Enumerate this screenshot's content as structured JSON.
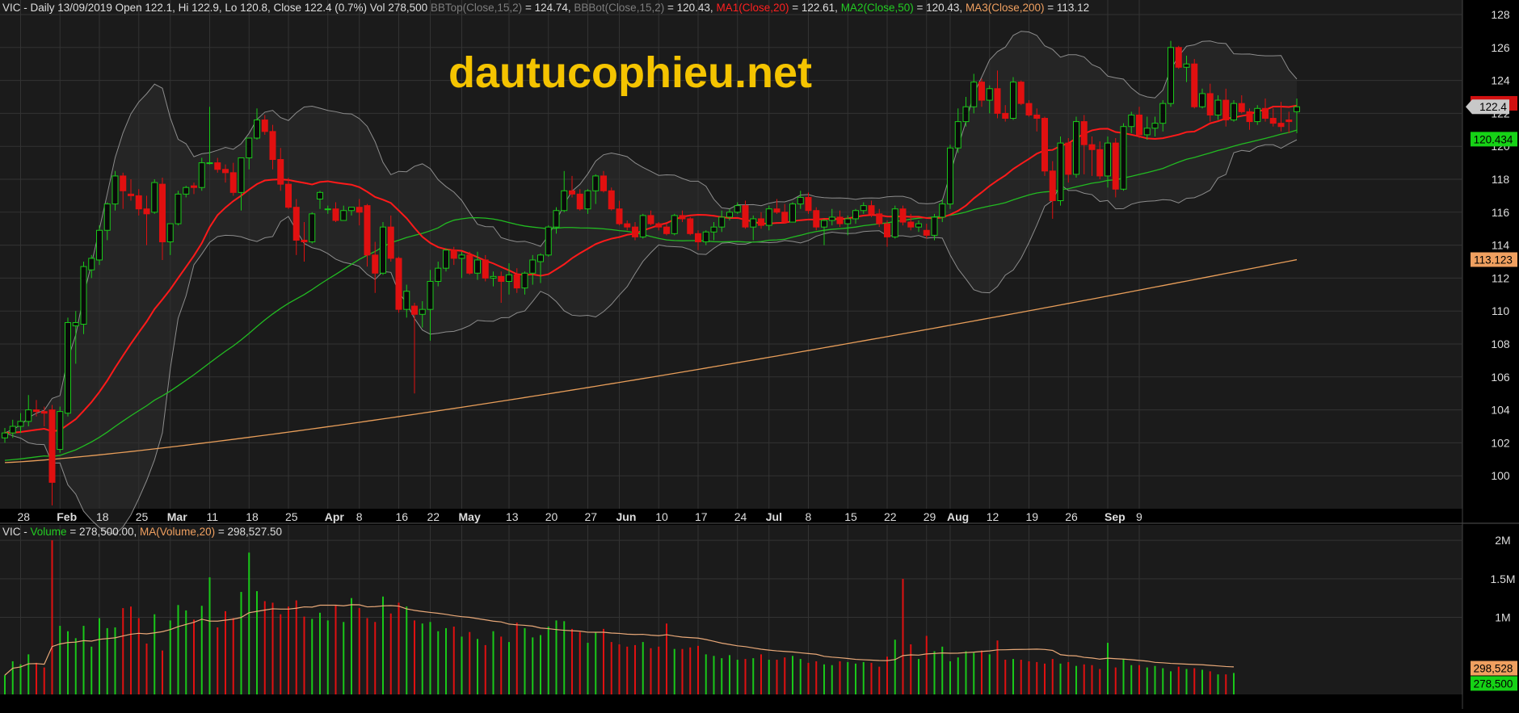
{
  "colors": {
    "background": "#000000",
    "panel": "#1b1b1b",
    "grid": "#333333",
    "up": "#19c819",
    "down": "#e01010",
    "ma20": "#ff1a1a",
    "ma50": "#22bb22",
    "ma200": "#e89e5a",
    "bollinger": "#8c8c8c",
    "volume_ma": "#e8a878",
    "watermark": "#f5c400",
    "text": "#dddddd"
  },
  "header": {
    "symbol": "VIC",
    "main_label": "VIC - Daily 13/09/2019 Open 122.1, Hi 122.9, Lo 120.8, Close 122.4 (0.7%) Vol 278,500",
    "bbtop_label": "BBTop(Close,15,2)",
    "bbtop_value": "= 124.74,",
    "bbbot_label": "BBBot(Close,15,2)",
    "bbbot_value": "= 120.43,",
    "ma1_label": "MA1(Close,20)",
    "ma1_value": "= 122.61,",
    "ma2_label": "MA2(Close,50)",
    "ma2_value": "= 120.43,",
    "ma3_label": "MA3(Close,200)",
    "ma3_value": "= 113.12",
    "volume_prefix": "VIC -",
    "volume_label": "Volume",
    "volume_value": "= 278,500.00,",
    "volume_ma_label": "MA(Volume,20)",
    "volume_ma_value": "= 298,527.50"
  },
  "watermark": "dautucophieu.net",
  "badges": {
    "ma20": "122.61",
    "close": "122.4",
    "ma50": "120.434",
    "ma200": "113.123",
    "vol_ma": "298,528",
    "vol": "278,500"
  },
  "chart_data": [
    {
      "type": "candlestick",
      "title": "VIC - Daily",
      "ylim": [
        98,
        128
      ],
      "yticks": [
        100,
        102,
        104,
        106,
        108,
        110,
        112,
        114,
        116,
        118,
        120,
        122,
        124,
        126,
        128
      ],
      "x_tick_labels": [
        "28",
        "Feb",
        "18",
        "25",
        "Mar",
        "11",
        "18",
        "25",
        "Apr",
        "8",
        "16",
        "22",
        "May",
        "13",
        "20",
        "27",
        "Jun",
        "10",
        "17",
        "24",
        "Jul",
        "8",
        "15",
        "22",
        "29",
        "Aug",
        "12",
        "19",
        "26",
        "Sep",
        "9"
      ],
      "x_tick_index": [
        2,
        7,
        12,
        17,
        21,
        26,
        31,
        36,
        41,
        45,
        50,
        54,
        58,
        64,
        69,
        74,
        78,
        83,
        88,
        93,
        97,
        102,
        107,
        112,
        117,
        120,
        125,
        130,
        135,
        140,
        144
      ],
      "ohlc": [
        [
          102.3,
          102.9,
          102.0,
          102.6
        ],
        [
          102.6,
          103.4,
          102.3,
          103.0
        ],
        [
          103.0,
          103.8,
          102.6,
          103.3
        ],
        [
          103.3,
          104.9,
          103.0,
          104.0
        ],
        [
          104.0,
          104.6,
          103.6,
          103.9
        ],
        [
          103.9,
          104.2,
          103.0,
          103.8
        ],
        [
          104.0,
          104.3,
          98.2,
          99.6
        ],
        [
          101.6,
          104.2,
          101.4,
          103.9
        ],
        [
          103.8,
          109.6,
          103.6,
          109.3
        ],
        [
          109.1,
          110.0,
          106.8,
          109.3
        ],
        [
          109.2,
          113.0,
          108.6,
          112.7
        ],
        [
          112.5,
          113.4,
          112.0,
          113.2
        ],
        [
          113.1,
          115.2,
          112.8,
          114.9
        ],
        [
          114.9,
          116.6,
          114.3,
          116.5
        ],
        [
          116.5,
          118.5,
          116.1,
          118.2
        ],
        [
          118.2,
          118.4,
          116.2,
          117.3
        ],
        [
          117.1,
          118.0,
          116.7,
          117.0
        ],
        [
          117.0,
          117.4,
          115.8,
          116.2
        ],
        [
          116.2,
          117.0,
          114.0,
          115.9
        ],
        [
          116.0,
          118.0,
          115.9,
          117.8
        ],
        [
          117.7,
          118.1,
          113.1,
          114.2
        ],
        [
          114.2,
          115.3,
          113.4,
          115.3
        ],
        [
          115.3,
          117.3,
          115.2,
          117.1
        ],
        [
          117.1,
          117.6,
          116.9,
          117.5
        ],
        [
          117.6,
          117.8,
          117.1,
          117.5
        ],
        [
          117.5,
          119.3,
          117.3,
          119.0
        ],
        [
          119.0,
          122.4,
          118.9,
          119.0
        ],
        [
          119.0,
          119.3,
          118.4,
          118.6
        ],
        [
          118.6,
          118.9,
          117.8,
          118.4
        ],
        [
          118.4,
          119.0,
          117.0,
          117.2
        ],
        [
          117.2,
          119.3,
          116.1,
          119.3
        ],
        [
          119.3,
          120.5,
          118.6,
          120.5
        ],
        [
          120.5,
          122.3,
          120.4,
          121.6
        ],
        [
          121.6,
          121.9,
          120.7,
          120.9
        ],
        [
          120.9,
          121.3,
          118.6,
          119.2
        ],
        [
          119.2,
          119.9,
          117.3,
          117.7
        ],
        [
          117.7,
          118.1,
          116.2,
          116.3
        ],
        [
          116.3,
          116.8,
          113.4,
          114.3
        ],
        [
          114.3,
          115.4,
          113.0,
          114.2
        ],
        [
          114.2,
          116.0,
          114.1,
          115.9
        ],
        [
          116.8,
          117.3,
          116.2,
          117.2
        ],
        [
          116.2,
          116.4,
          115.9,
          116.2
        ],
        [
          116.2,
          116.6,
          115.4,
          115.5
        ],
        [
          115.5,
          116.4,
          115.5,
          116.1
        ],
        [
          116.1,
          116.3,
          115.8,
          116.3
        ],
        [
          116.3,
          116.8,
          115.2,
          116.0
        ],
        [
          116.4,
          116.5,
          112.7,
          113.4
        ],
        [
          113.4,
          114.2,
          111.1,
          112.3
        ],
        [
          112.3,
          115.4,
          112.2,
          115.1
        ],
        [
          115.1,
          115.8,
          113.0,
          113.2
        ],
        [
          113.2,
          113.3,
          109.9,
          110.1
        ],
        [
          110.1,
          111.6,
          109.6,
          111.2
        ],
        [
          110.3,
          110.5,
          105.0,
          109.8
        ],
        [
          109.8,
          110.6,
          109.0,
          110.1
        ],
        [
          110.1,
          112.5,
          108.2,
          111.8
        ],
        [
          111.8,
          113.0,
          111.5,
          112.6
        ],
        [
          112.6,
          113.8,
          112.4,
          113.7
        ],
        [
          113.7,
          113.9,
          112.8,
          113.2
        ],
        [
          113.2,
          113.6,
          112.0,
          113.4
        ],
        [
          113.4,
          113.6,
          112.2,
          112.3
        ],
        [
          112.3,
          113.6,
          111.9,
          113.1
        ],
        [
          113.1,
          113.4,
          111.8,
          112.0
        ],
        [
          112.0,
          112.4,
          111.5,
          112.1
        ],
        [
          112.1,
          112.4,
          110.5,
          111.8
        ],
        [
          111.8,
          112.9,
          111.0,
          112.2
        ],
        [
          112.2,
          112.6,
          111.1,
          111.4
        ],
        [
          111.4,
          112.4,
          111.0,
          112.3
        ],
        [
          112.3,
          113.4,
          111.6,
          113.1
        ],
        [
          113.0,
          113.5,
          111.7,
          113.4
        ],
        [
          113.4,
          115.2,
          113.3,
          115.1
        ],
        [
          115.1,
          116.3,
          114.7,
          116.1
        ],
        [
          116.1,
          118.5,
          116.0,
          117.3
        ],
        [
          117.3,
          118.2,
          116.9,
          117.1
        ],
        [
          117.1,
          117.4,
          116.1,
          116.2
        ],
        [
          116.2,
          117.4,
          115.9,
          117.3
        ],
        [
          117.3,
          118.3,
          116.5,
          118.2
        ],
        [
          118.2,
          118.5,
          117.2,
          117.3
        ],
        [
          117.3,
          117.5,
          116.1,
          116.2
        ],
        [
          116.2,
          116.7,
          115.2,
          115.3
        ],
        [
          115.3,
          115.5,
          114.9,
          115.1
        ],
        [
          115.1,
          115.4,
          114.3,
          114.5
        ],
        [
          114.5,
          115.9,
          114.4,
          115.8
        ],
        [
          115.8,
          116.1,
          115.2,
          115.3
        ],
        [
          115.3,
          115.4,
          114.9,
          115.1
        ],
        [
          115.1,
          115.3,
          114.6,
          114.7
        ],
        [
          114.7,
          115.9,
          114.6,
          115.8
        ],
        [
          115.8,
          116.1,
          115.4,
          115.6
        ],
        [
          115.6,
          115.7,
          114.6,
          114.7
        ],
        [
          114.7,
          114.9,
          113.7,
          114.2
        ],
        [
          114.2,
          114.9,
          114.0,
          114.8
        ],
        [
          114.8,
          115.4,
          114.3,
          115.1
        ],
        [
          115.1,
          116.1,
          114.8,
          115.7
        ],
        [
          115.7,
          116.2,
          115.5,
          116.0
        ],
        [
          116.0,
          116.6,
          115.9,
          116.4
        ],
        [
          116.4,
          116.7,
          115.0,
          115.1
        ],
        [
          115.1,
          115.8,
          114.3,
          115.6
        ],
        [
          115.6,
          116.0,
          115.0,
          115.2
        ],
        [
          115.2,
          116.4,
          114.9,
          116.2
        ],
        [
          116.2,
          116.8,
          115.9,
          116.0
        ],
        [
          116.0,
          116.5,
          115.3,
          115.4
        ],
        [
          115.4,
          116.6,
          115.4,
          116.5
        ],
        [
          116.5,
          117.3,
          116.2,
          116.9
        ],
        [
          116.9,
          117.2,
          115.9,
          116.1
        ],
        [
          116.1,
          116.3,
          114.9,
          115.1
        ],
        [
          115.1,
          115.6,
          114.0,
          115.5
        ],
        [
          115.5,
          116.2,
          115.2,
          115.7
        ],
        [
          115.7,
          116.1,
          115.1,
          115.3
        ],
        [
          115.3,
          115.8,
          114.6,
          115.6
        ],
        [
          115.6,
          116.2,
          115.3,
          116.1
        ],
        [
          116.1,
          116.6,
          115.9,
          116.4
        ],
        [
          116.4,
          116.7,
          115.7,
          115.9
        ],
        [
          115.9,
          116.2,
          115.1,
          115.3
        ],
        [
          115.3,
          115.5,
          113.9,
          114.5
        ],
        [
          114.5,
          116.4,
          114.4,
          116.2
        ],
        [
          116.2,
          116.4,
          115.2,
          115.4
        ],
        [
          115.4,
          115.9,
          114.9,
          115.1
        ],
        [
          115.1,
          115.5,
          114.8,
          115.3
        ],
        [
          114.9,
          115.3,
          114.4,
          114.6
        ],
        [
          114.6,
          115.9,
          114.3,
          115.7
        ],
        [
          115.7,
          116.8,
          115.4,
          116.5
        ],
        [
          116.5,
          120.1,
          116.2,
          119.9
        ],
        [
          119.9,
          122.3,
          119.6,
          121.5
        ],
        [
          121.5,
          123.0,
          121.2,
          122.4
        ],
        [
          122.4,
          124.4,
          122.0,
          123.9
        ],
        [
          123.9,
          124.1,
          122.4,
          122.8
        ],
        [
          122.8,
          123.7,
          122.0,
          123.5
        ],
        [
          123.5,
          124.6,
          121.7,
          122.0
        ],
        [
          122.0,
          122.5,
          121.5,
          121.7
        ],
        [
          121.7,
          124.2,
          121.6,
          123.9
        ],
        [
          123.9,
          124.0,
          122.5,
          122.6
        ],
        [
          122.6,
          122.8,
          121.8,
          121.9
        ],
        [
          121.9,
          122.3,
          120.9,
          121.7
        ],
        [
          121.7,
          121.8,
          118.2,
          118.5
        ],
        [
          118.5,
          119.1,
          115.6,
          116.7
        ],
        [
          116.7,
          120.6,
          116.4,
          120.2
        ],
        [
          120.2,
          120.5,
          117.8,
          118.3
        ],
        [
          118.3,
          121.8,
          118.1,
          121.5
        ],
        [
          121.5,
          121.9,
          118.3,
          120.1
        ],
        [
          120.1,
          120.6,
          118.2,
          119.8
        ],
        [
          119.8,
          120.3,
          118.0,
          118.2
        ],
        [
          118.2,
          120.6,
          117.5,
          120.2
        ],
        [
          120.2,
          120.5,
          116.9,
          117.4
        ],
        [
          117.4,
          121.4,
          117.3,
          121.2
        ],
        [
          121.2,
          122.1,
          120.8,
          121.9
        ],
        [
          121.9,
          122.4,
          120.5,
          120.7
        ],
        [
          120.7,
          121.8,
          120.4,
          121.1
        ],
        [
          121.1,
          121.8,
          120.6,
          121.4
        ],
        [
          121.4,
          122.8,
          120.9,
          122.6
        ],
        [
          122.6,
          126.4,
          122.4,
          126.0
        ],
        [
          126.0,
          126.1,
          124.7,
          124.8
        ],
        [
          124.8,
          125.5,
          123.9,
          125.0
        ],
        [
          125.0,
          125.3,
          122.3,
          122.4
        ],
        [
          122.4,
          123.5,
          122.3,
          123.2
        ],
        [
          123.2,
          123.8,
          121.5,
          121.9
        ],
        [
          121.9,
          123.1,
          121.6,
          122.8
        ],
        [
          122.8,
          123.5,
          121.2,
          121.6
        ],
        [
          121.6,
          122.8,
          121.5,
          122.6
        ],
        [
          122.6,
          123.1,
          122.0,
          122.1
        ],
        [
          122.1,
          122.3,
          121.0,
          121.5
        ],
        [
          121.5,
          122.5,
          121.3,
          122.3
        ],
        [
          122.3,
          122.9,
          121.5,
          121.7
        ],
        [
          121.7,
          122.3,
          121.2,
          121.4
        ],
        [
          121.4,
          122.7,
          120.9,
          121.2
        ],
        [
          121.6,
          122.1,
          120.8,
          121.5
        ],
        [
          122.1,
          122.9,
          120.8,
          122.4
        ]
      ],
      "volume": [
        250000,
        430000,
        390000,
        520000,
        410000,
        350000,
        2000000,
        890000,
        820000,
        730000,
        890000,
        620000,
        990000,
        860000,
        870000,
        1120000,
        1140000,
        990000,
        660000,
        1040000,
        570000,
        960000,
        1160000,
        1090000,
        970000,
        1150000,
        1520000,
        870000,
        1080000,
        990000,
        1330000,
        1840000,
        1340000,
        1210000,
        1190000,
        1040000,
        1140000,
        1220000,
        1010000,
        980000,
        1060000,
        960000,
        1160000,
        940000,
        1250000,
        1120000,
        990000,
        940000,
        1270000,
        1050000,
        1190000,
        1140000,
        960000,
        920000,
        940000,
        820000,
        860000,
        880000,
        750000,
        810000,
        720000,
        640000,
        820000,
        750000,
        680000,
        930000,
        860000,
        740000,
        770000,
        880000,
        960000,
        950000,
        850000,
        810000,
        670000,
        810000,
        850000,
        680000,
        650000,
        620000,
        640000,
        680000,
        600000,
        620000,
        920000,
        590000,
        590000,
        610000,
        630000,
        520000,
        500000,
        470000,
        510000,
        450000,
        460000,
        470000,
        520000,
        450000,
        450000,
        480000,
        500000,
        460000,
        410000,
        430000,
        390000,
        380000,
        430000,
        420000,
        400000,
        420000,
        410000,
        360000,
        490000,
        710000,
        1500000,
        650000,
        460000,
        760000,
        560000,
        620000,
        430000,
        480000,
        560000,
        540000,
        570000,
        520000,
        700000,
        450000,
        460000,
        450000,
        430000,
        420000,
        400000,
        460000,
        400000,
        420000,
        370000,
        390000,
        380000,
        330000,
        670000,
        350000,
        460000,
        380000,
        380000,
        350000,
        370000,
        340000,
        300000,
        360000,
        330000,
        340000,
        320000,
        300000,
        260000,
        260000,
        278500
      ],
      "volume_axis_ticks": [
        [
          "2M",
          2000000
        ],
        [
          "1.5M",
          1500000
        ],
        [
          "1M",
          1000000
        ]
      ],
      "volume_ylim": [
        0,
        2200000
      ]
    }
  ]
}
